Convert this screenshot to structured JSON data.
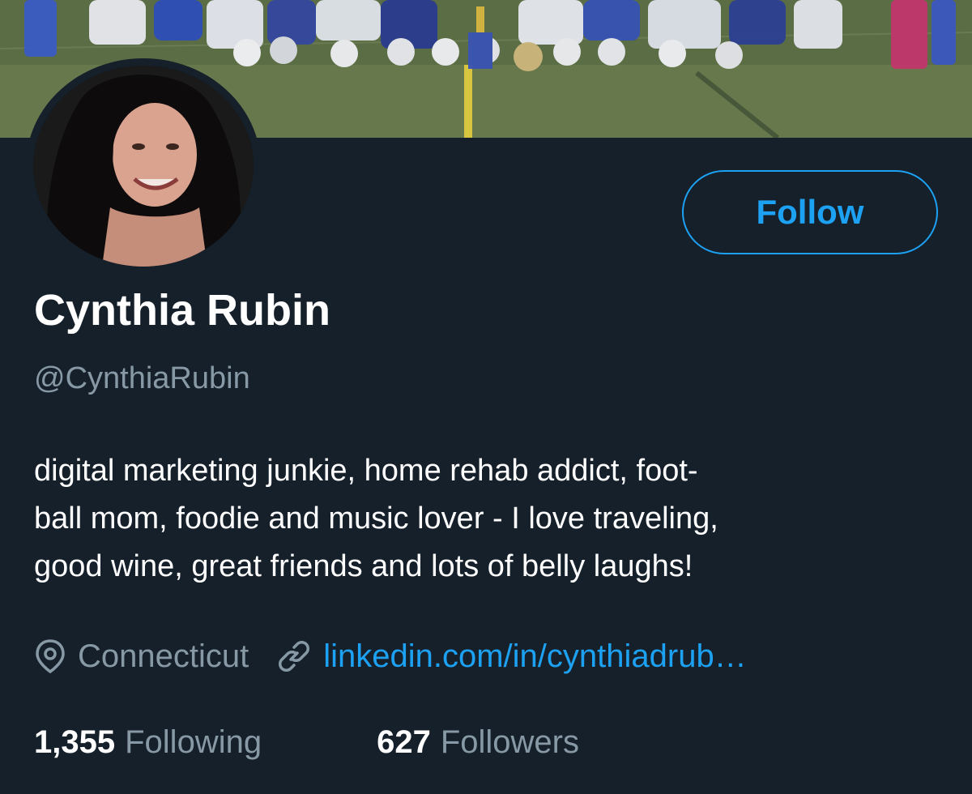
{
  "profile": {
    "name": "Cynthia Rubin",
    "handle": "@CynthiaRubin",
    "bio_lines": [
      "digital marketing junkie, home rehab addict, foot-",
      "ball mom, foodie and music lover - I love traveling,",
      "good wine, great friends and lots of belly laughs!"
    ],
    "location": "Connecticut",
    "website": "linkedin.com/in/cynthiadrub…",
    "following_count": "1,355",
    "following_label": "Following",
    "followers_count": "627",
    "followers_label": "Followers"
  },
  "actions": {
    "follow_label": "Follow"
  },
  "icons": {
    "location": "map-pin-icon",
    "link": "link-icon"
  },
  "colors": {
    "background": "#15202b",
    "accent": "#1da1f2",
    "secondary_text": "#8899a6",
    "primary_text": "#ffffff"
  }
}
